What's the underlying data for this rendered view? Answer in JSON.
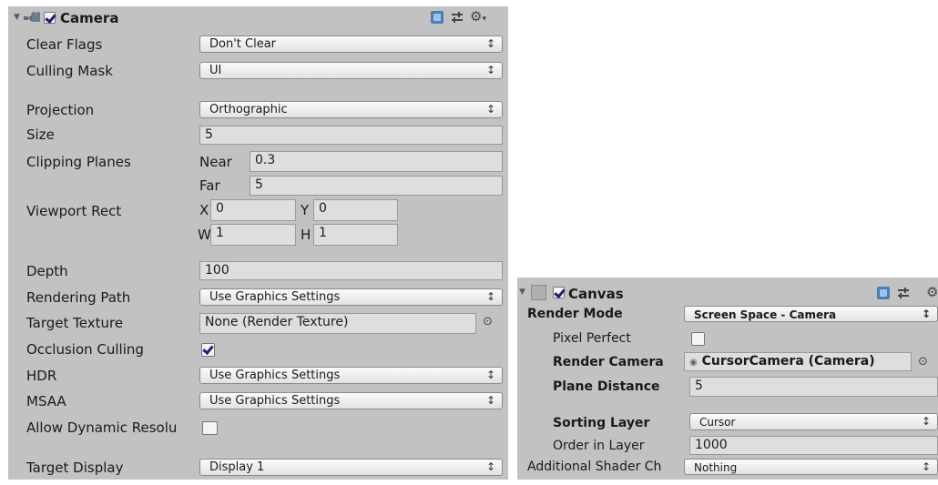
{
  "camera": {
    "title": "Camera",
    "enabled": true,
    "clear_flags": {
      "label": "Clear Flags",
      "value": "Don't Clear"
    },
    "culling_mask": {
      "label": "Culling Mask",
      "value": "UI"
    },
    "projection": {
      "label": "Projection",
      "value": "Orthographic"
    },
    "size": {
      "label": "Size",
      "value": "5"
    },
    "clipping_planes": {
      "label": "Clipping Planes",
      "near_label": "Near",
      "near": "0.3",
      "far_label": "Far",
      "far": "5"
    },
    "viewport_rect": {
      "label": "Viewport Rect",
      "x_label": "X",
      "x": "0",
      "y_label": "Y",
      "y": "0",
      "w_label": "W",
      "w": "1",
      "h_label": "H",
      "h": "1"
    },
    "depth": {
      "label": "Depth",
      "value": "100"
    },
    "rendering_path": {
      "label": "Rendering Path",
      "value": "Use Graphics Settings"
    },
    "target_texture": {
      "label": "Target Texture",
      "value": "None (Render Texture)"
    },
    "occlusion_culling": {
      "label": "Occlusion Culling",
      "checked": true
    },
    "hdr": {
      "label": "HDR",
      "value": "Use Graphics Settings"
    },
    "msaa": {
      "label": "MSAA",
      "value": "Use Graphics Settings"
    },
    "allow_dynamic_resolution": {
      "label": "Allow Dynamic Resolu",
      "checked": false
    },
    "target_display": {
      "label": "Target Display",
      "value": "Display 1"
    }
  },
  "canvas": {
    "title": "Canvas",
    "enabled": true,
    "render_mode": {
      "label": "Render Mode",
      "value": "Screen Space - Camera"
    },
    "pixel_perfect": {
      "label": "Pixel Perfect",
      "checked": false
    },
    "render_camera": {
      "label": "Render Camera",
      "value": "CursorCamera (Camera)"
    },
    "plane_distance": {
      "label": "Plane Distance",
      "value": "5"
    },
    "sorting_layer": {
      "label": "Sorting Layer",
      "value": "Cursor"
    },
    "order_in_layer": {
      "label": "Order in Layer",
      "value": "1000"
    },
    "additional_shader_channels": {
      "label": "Additional Shader Ch",
      "value": "Nothing"
    }
  },
  "icons": [
    "foldout-arrow-icon",
    "camera-component-icon",
    "canvas-component-icon",
    "help-book-icon",
    "preset-sliders-icon",
    "settings-gear-icon",
    "object-picker-icon",
    "dropdown-arrow-icon"
  ],
  "colors": {
    "panel_bg": "#c2c2c2",
    "field_bg": "#dedede",
    "check_color": "#1f1f7a"
  }
}
